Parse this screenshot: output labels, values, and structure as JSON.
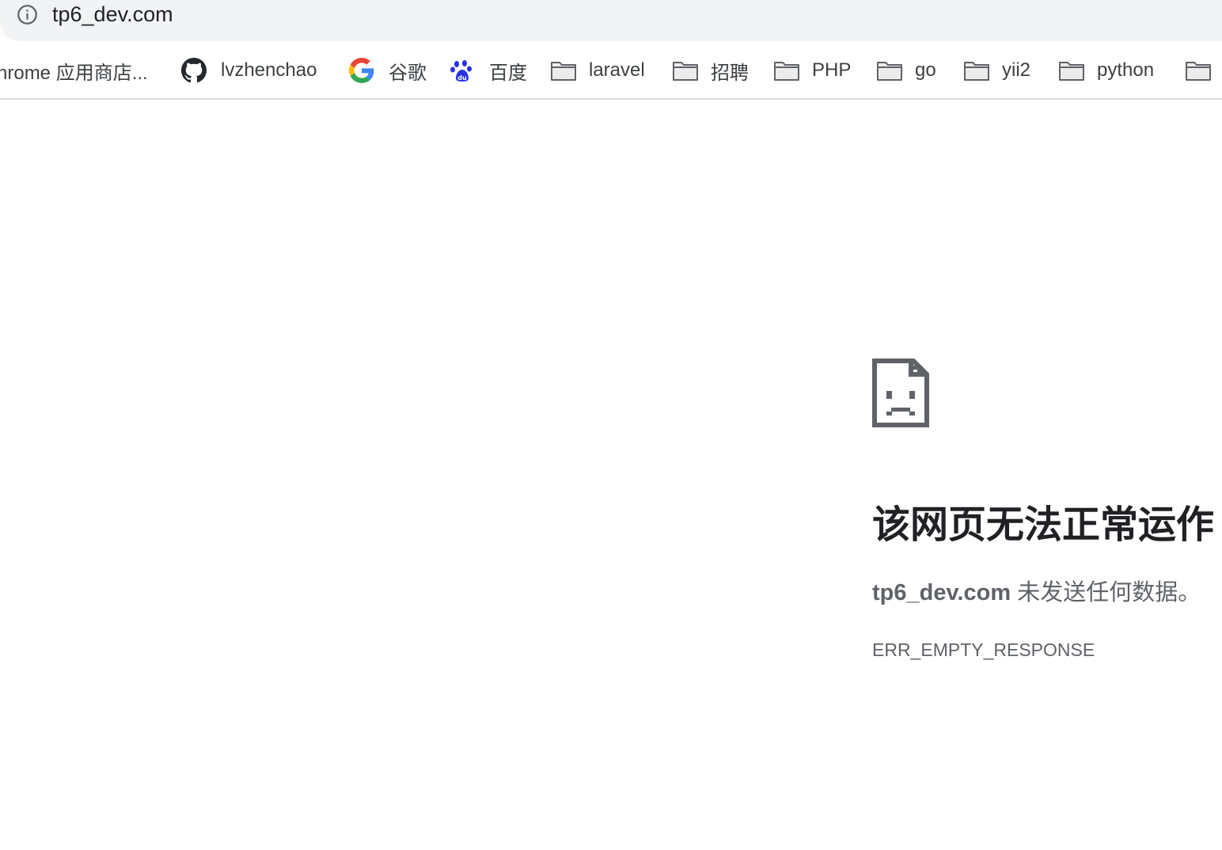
{
  "address_bar": {
    "url": "tp6_dev.com",
    "icon": "info-icon"
  },
  "bookmarks": [
    {
      "label": "hrome 应用商店...",
      "icon": "none"
    },
    {
      "label": "lvzhenchao",
      "icon": "github-icon"
    },
    {
      "label": "谷歌",
      "icon": "google-icon"
    },
    {
      "label": "百度",
      "icon": "baidu-icon"
    },
    {
      "label": "laravel",
      "icon": "folder-icon"
    },
    {
      "label": "招聘",
      "icon": "folder-icon"
    },
    {
      "label": "PHP",
      "icon": "folder-icon"
    },
    {
      "label": "go",
      "icon": "folder-icon"
    },
    {
      "label": "yii2",
      "icon": "folder-icon"
    },
    {
      "label": "python",
      "icon": "folder-icon"
    },
    {
      "label": "",
      "icon": "folder-icon"
    }
  ],
  "error": {
    "icon": "sad-page-icon",
    "title": "该网页无法正常运作",
    "host": "tp6_dev.com",
    "message": " 未发送任何数据。",
    "code": "ERR_EMPTY_RESPONSE"
  },
  "colors": {
    "omnibox_bg": "#f1f3f4",
    "text_primary": "#202124",
    "text_secondary": "#5f6368",
    "folder_gray": "#5f6368"
  }
}
